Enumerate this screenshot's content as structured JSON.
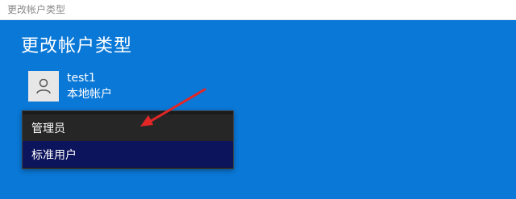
{
  "window": {
    "title": "更改帐户类型",
    "background_color": "#0a78d7"
  },
  "page": {
    "heading": "更改帐户类型"
  },
  "account": {
    "name": "test1",
    "type": "本地帐户",
    "avatar_icon": "person-icon"
  },
  "dropdown": {
    "options": [
      {
        "label": "管理员",
        "selected": false
      },
      {
        "label": "标准用户",
        "selected": true
      }
    ],
    "selected_value": "标准用户"
  },
  "annotation": {
    "arrow_color": "#e32626",
    "icon": "red-arrow-annotation"
  }
}
